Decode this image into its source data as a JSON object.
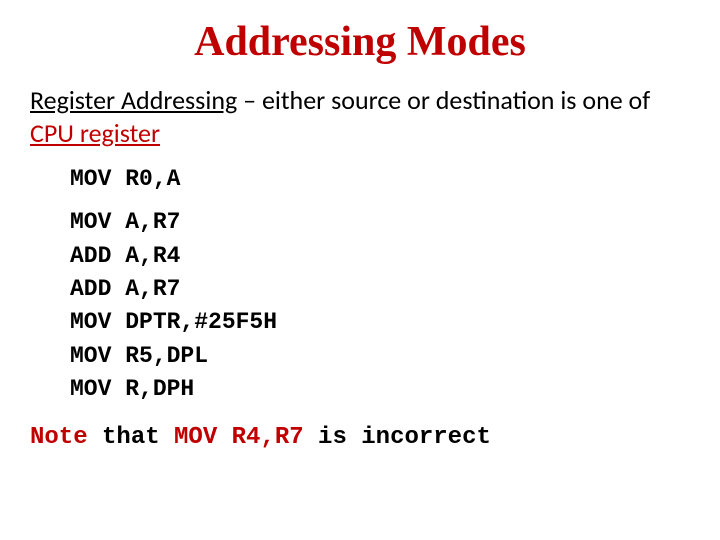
{
  "title": "Addressing Modes",
  "intro": {
    "mode_name": "Register Addressing",
    "dash": " – ",
    "desc1": "either source or destination is one of ",
    "cpu_reg": "CPU register"
  },
  "code": {
    "l0": "MOV R0,A",
    "l1": "MOV A,R7",
    "l2": "ADD A,R4",
    "l3": "ADD A,R7",
    "l4": "MOV DPTR,#25F5H",
    "l5": "MOV R5,DPL",
    "l6": "MOV R,DPH"
  },
  "note": {
    "word_note": "Note",
    "mid1": " that ",
    "bad_instr": "MOV R4,R7",
    "mid2": " is incorrect"
  }
}
